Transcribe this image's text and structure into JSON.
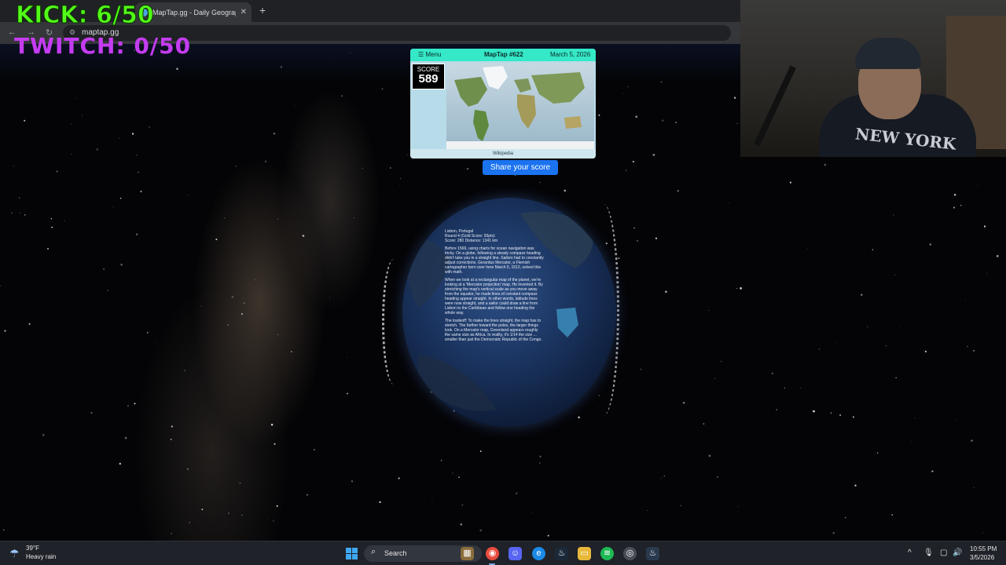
{
  "browser": {
    "tab_title": "MapTap.gg - Daily Geography G",
    "tab_close": "✕",
    "new_tab": "+",
    "url": "maptap.gg",
    "back": "←",
    "forward": "→",
    "reload": "↻"
  },
  "overlay": {
    "kick": "KICK: 6/50",
    "twitch": "TWITCH: 0/50",
    "kick_color": "#53fc18",
    "twitch_color": "#c53cf2"
  },
  "maptap": {
    "menu_label": "☰ Menu",
    "title": "MapTap #622",
    "date": "March 5, 2026",
    "score_label": "SCORE",
    "score_value": "589",
    "map_caption": "Wikipedia",
    "share_button": "Share your score",
    "accent_color": "#35e8c7",
    "share_color": "#1b73f0"
  },
  "globe_overlay": {
    "header": [
      "Lisbon, Portugal",
      "Round 4 (Gold Score: 93pts)",
      "Score: 280  Distance: 1341 km"
    ],
    "paragraphs": [
      "Before 1569, using charts for ocean navigation was tricky. On a globe, following a steady compass heading didn't take you in a straight line. Sailors had to constantly adjust corrections. Gerardus Mercator, a Flemish cartographer born over here March 5, 1512, solved this with math.",
      "When we look at a rectangular map of the planet, we're looking at a 'Mercator projection' map. He invented it. By stretching the map's vertical scale as you move away from the equator, he made lines of constant compass heading appear straight. In other words, latitude lines were now straight, and a sailor could draw a line from Lisbon to the Caribbean and follow one heading the whole way.",
      "The tradeoff: To make the lines straight, the map has to stretch. The farther toward the poles, the larger things look. On a Mercator map, Greenland appears roughly the same size as Africa. In reality, it's 1/14 the size ... smaller than just the Democratic Republic of the Congo."
    ]
  },
  "taskbar": {
    "weather_temp": "39°F",
    "weather_desc": "Heavy rain",
    "search_label": "Search",
    "time": "10:55 PM",
    "date": "3/5/2026",
    "tray_icons": [
      "^",
      "🎙",
      "▢",
      "🔊"
    ]
  }
}
